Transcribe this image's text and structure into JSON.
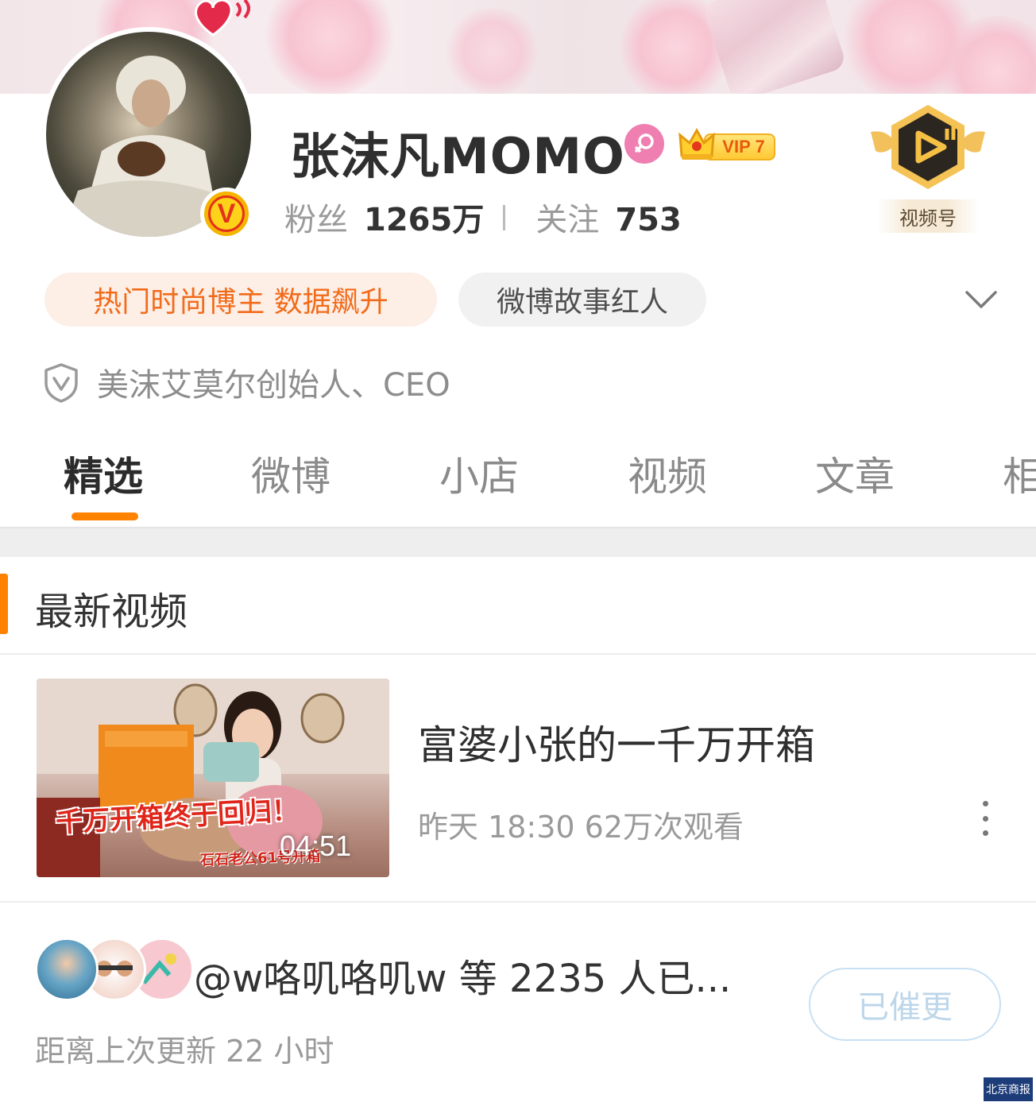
{
  "profile": {
    "name": "张沫凡MOMO",
    "vip_label": "VIP 7",
    "fans_label": "粉丝",
    "fans_count": "1265万",
    "follow_label": "关注",
    "follow_count": "753",
    "video_badge_label": "视频号"
  },
  "tags": {
    "hot": "热门时尚博主 数据飙升",
    "story": "微博故事红人"
  },
  "certification": "美沫艾莫尔创始人、CEO",
  "tabs": [
    {
      "label": "精选",
      "active": true
    },
    {
      "label": "微博",
      "active": false
    },
    {
      "label": "小店",
      "active": false
    },
    {
      "label": "视频",
      "active": false
    },
    {
      "label": "文章",
      "active": false
    },
    {
      "label": "相",
      "active": false
    }
  ],
  "section": {
    "title": "最新视频"
  },
  "video": {
    "title": "富婆小张的一千万开箱",
    "meta": "昨天 18:30 62万次观看",
    "duration": "04:51",
    "caption_main": "千万开箱终于回归！",
    "caption_sub": "石石老公61号开箱"
  },
  "update": {
    "urge_text": "@w咯叽咯叽w 等 2235 人已...",
    "since_text": "距离上次更新 22 小时",
    "urge_button": "已催更"
  },
  "watermark": "北京商报",
  "colors": {
    "accent": "#ff8200",
    "hot_tag_text": "#f26b1a",
    "female_badge": "#f07fb1",
    "vip_gold": "#ffc933"
  }
}
